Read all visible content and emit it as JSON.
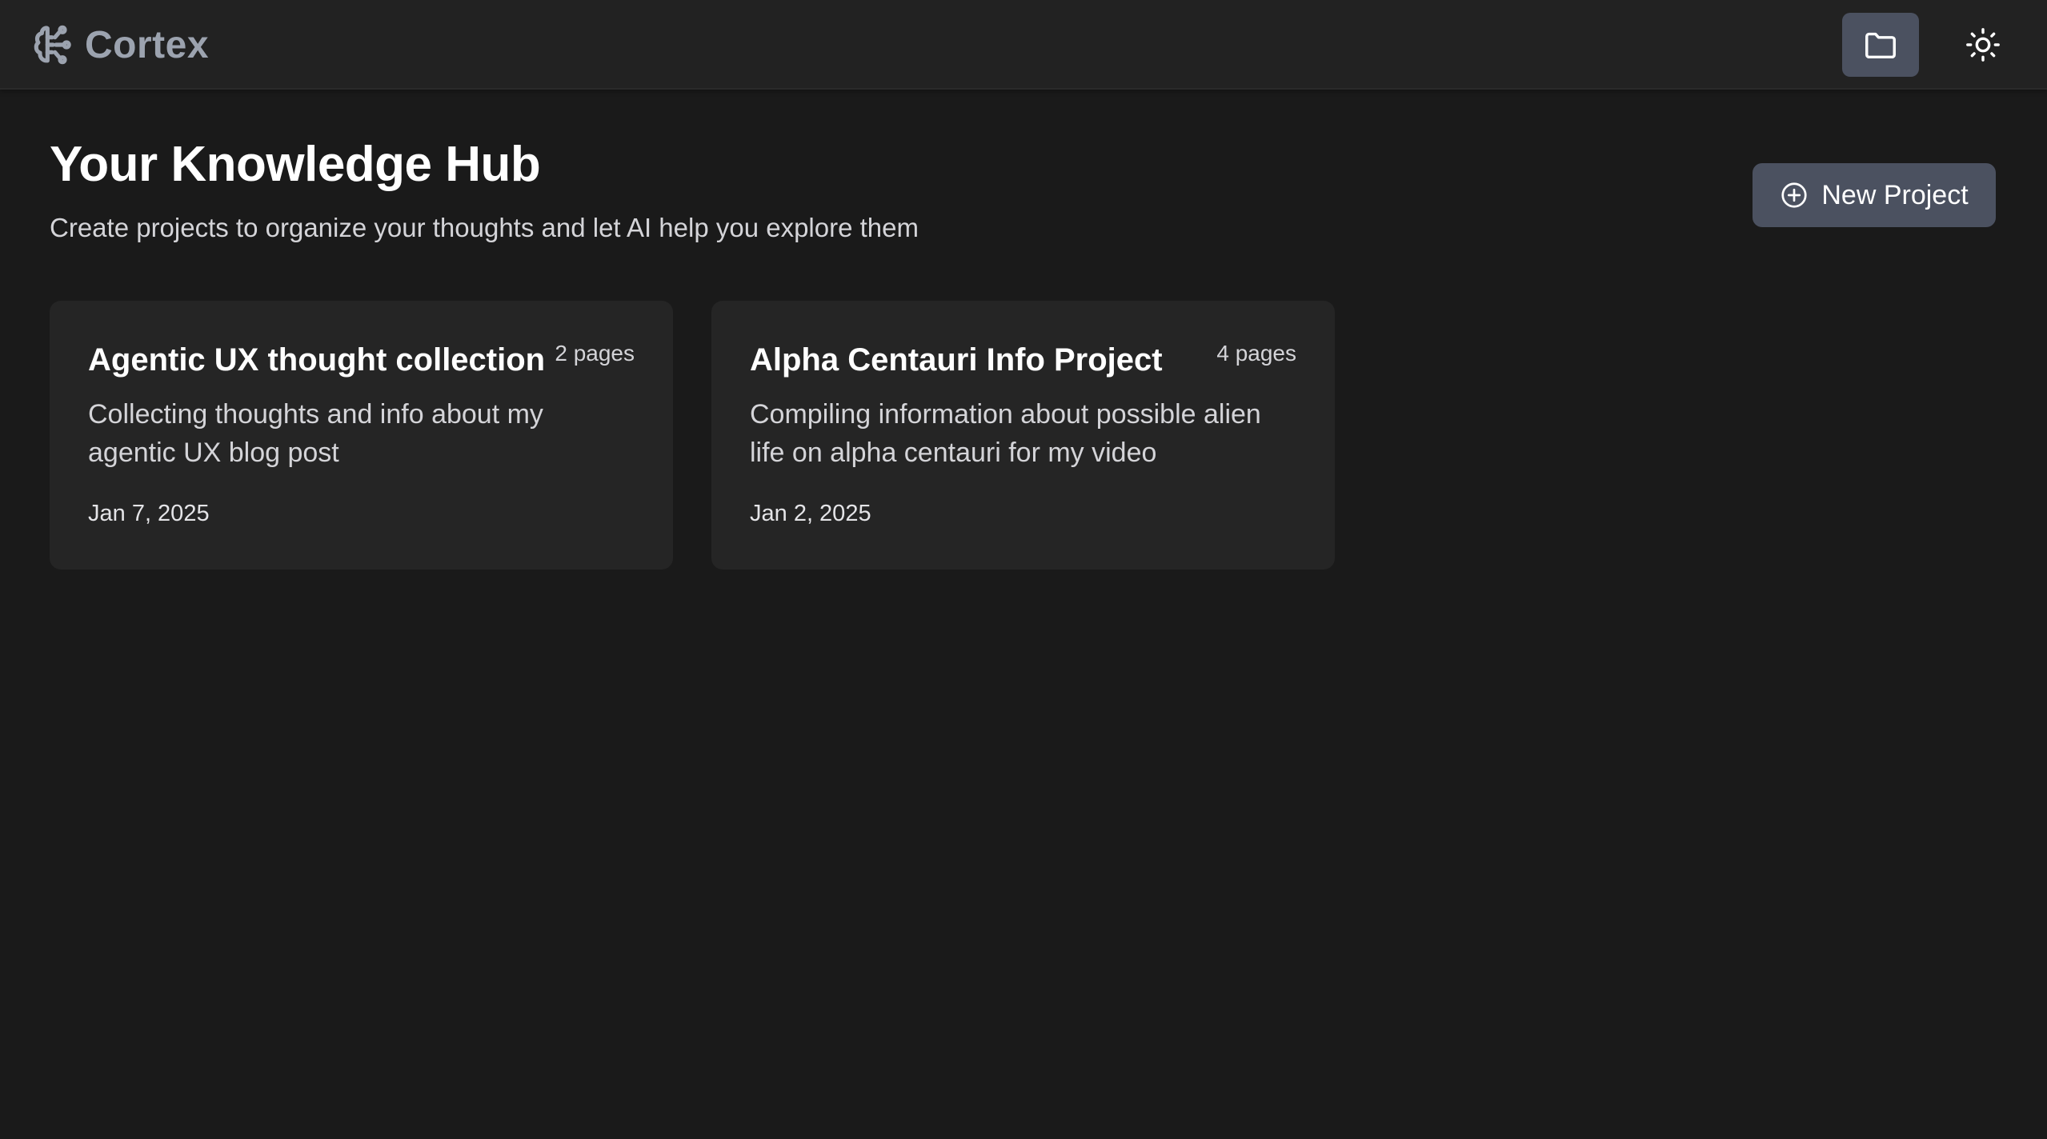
{
  "app": {
    "name": "Cortex",
    "brand_icon": "brain-icon"
  },
  "header": {
    "projects_icon": "folder-icon",
    "theme_icon": "sun-icon"
  },
  "hero": {
    "title": "Your Knowledge Hub",
    "subtitle": "Create projects to organize your thoughts and let AI help you explore them"
  },
  "actions": {
    "new_project_label": "New Project",
    "new_project_icon": "plus-circle-icon"
  },
  "projects": [
    {
      "title": "Agentic UX thought collection",
      "pages": "2 pages",
      "description": "Collecting thoughts and info about my agentic UX blog post",
      "date": "Jan 7, 2025"
    },
    {
      "title": "Alpha Centauri Info Project",
      "pages": "4 pages",
      "description": "Compiling information about possible alien life on alpha centauri for my video",
      "date": "Jan 2, 2025"
    }
  ],
  "colors": {
    "background": "#1a1a1a",
    "topbar": "#222222",
    "card": "#252525",
    "button": "#4b5160",
    "brand_text": "#9ca3af"
  }
}
